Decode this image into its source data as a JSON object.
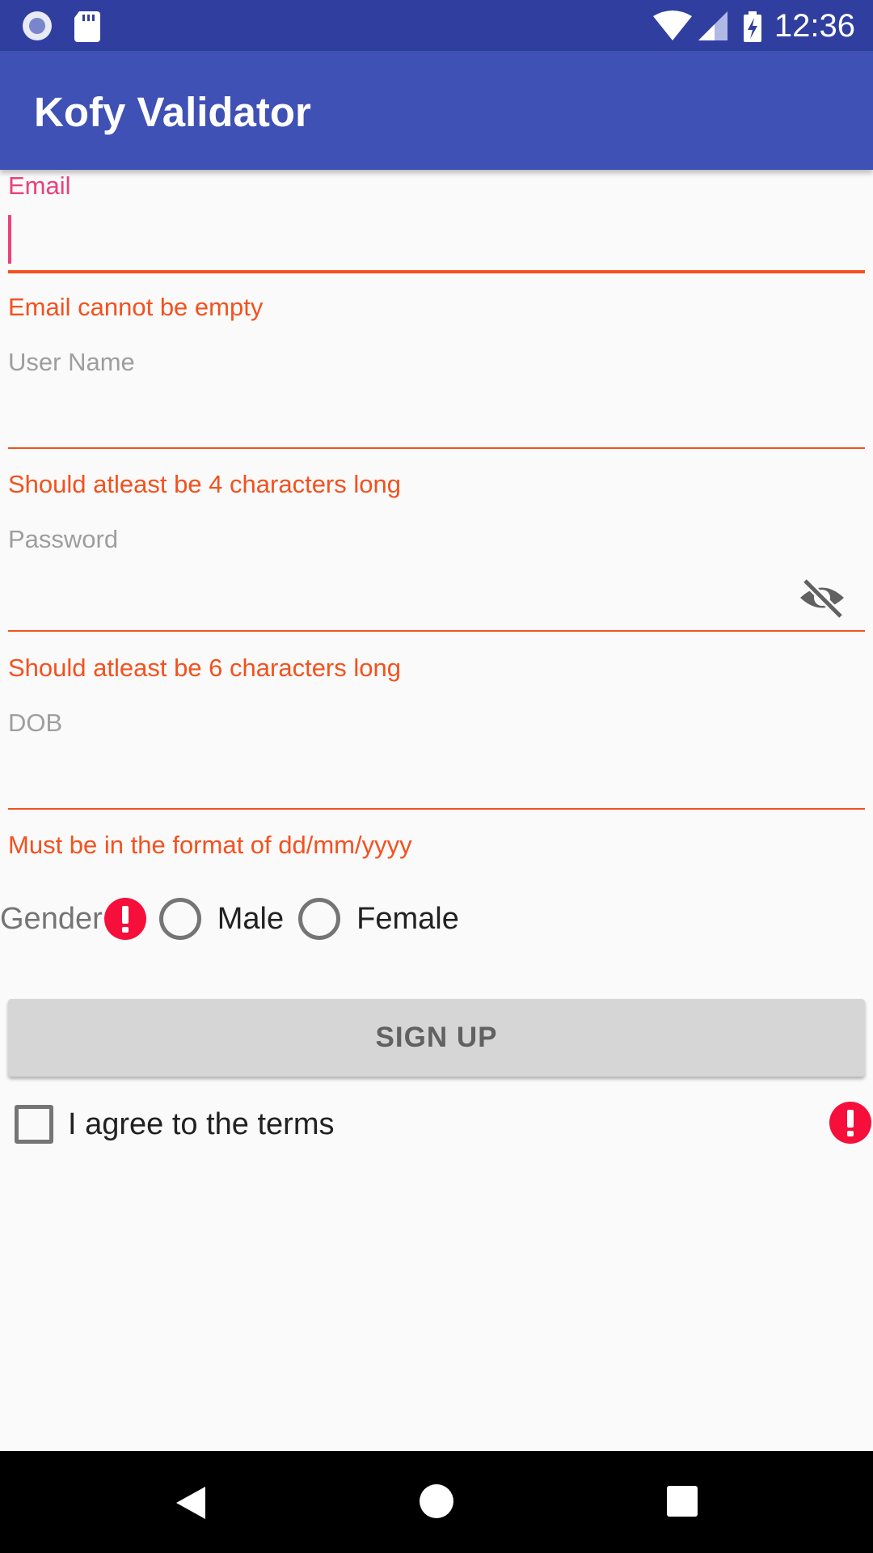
{
  "status_bar": {
    "time": "12:36",
    "colors": {
      "background": "#303f9f"
    },
    "icons": [
      "record-icon",
      "sd-card-icon",
      "wifi-icon",
      "signal-icon",
      "battery-charging-icon"
    ]
  },
  "app_bar": {
    "title": "Kofy Validator",
    "color": "#3f51b5"
  },
  "form": {
    "email": {
      "label": "Email",
      "value": "",
      "error": "Email cannot be empty"
    },
    "username": {
      "label": "User Name",
      "value": "",
      "error": "Should atleast be 4 characters long"
    },
    "password": {
      "label": "Password",
      "value": "",
      "error": "Should atleast be 6 characters long",
      "toggle_icon": "visibility-off-icon"
    },
    "dob": {
      "label": "DOB",
      "value": "",
      "error": "Must be in the format of dd/mm/yyyy"
    },
    "gender": {
      "label": "Gender",
      "error_icon": "error-icon",
      "options": [
        {
          "label": "Male",
          "selected": false
        },
        {
          "label": "Female",
          "selected": false
        }
      ]
    },
    "signup_label": "SIGN UP",
    "terms": {
      "label": "I agree to the terms",
      "checked": false,
      "error_icon": "error-icon"
    }
  },
  "colors": {
    "accent": "#ec407a",
    "error": "#f4511e",
    "error_icon": "#f50f3a",
    "hint": "#9e9e9e"
  },
  "nav_bar": {
    "icons": [
      "back-icon",
      "home-icon",
      "recents-icon"
    ]
  }
}
